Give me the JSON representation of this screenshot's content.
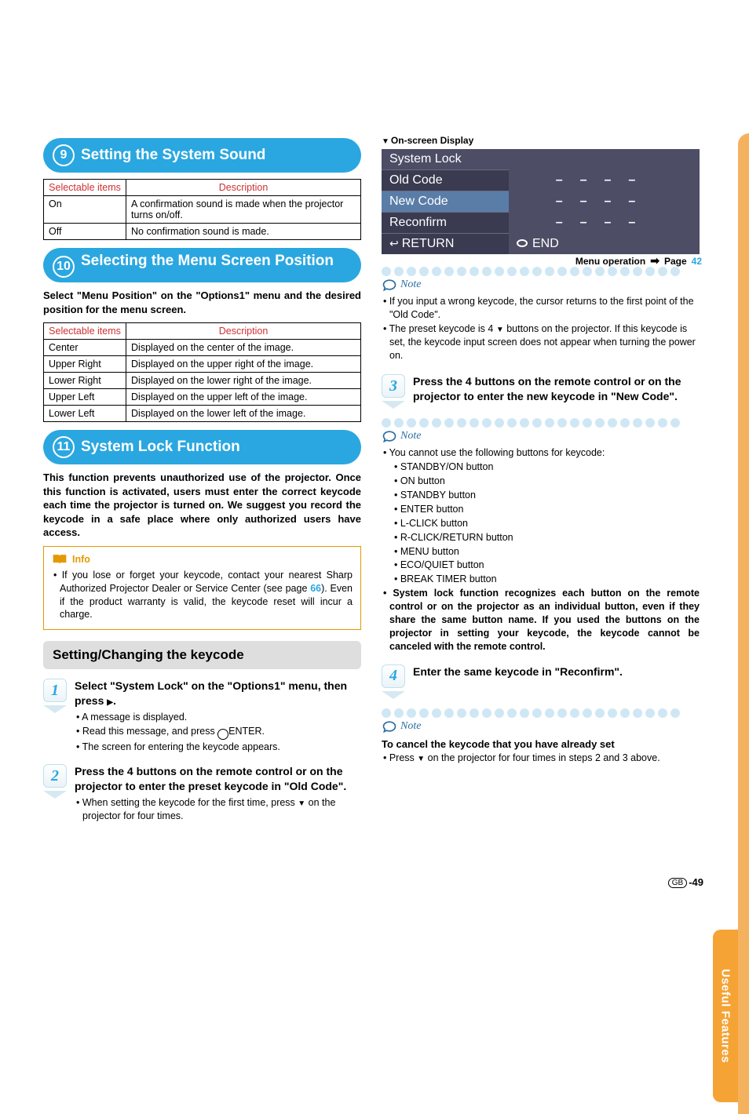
{
  "menuop": {
    "label": "Menu operation",
    "page_word": "Page",
    "page_num": "42"
  },
  "left": {
    "sec9": {
      "num": "9",
      "title": "Setting the System Sound",
      "table_headers": [
        "Selectable items",
        "Description"
      ],
      "rows": [
        {
          "item": "On",
          "desc": "A confirmation sound is made when the projector turns on/off."
        },
        {
          "item": "Off",
          "desc": "No confirmation sound is made."
        }
      ]
    },
    "sec10": {
      "num": "10",
      "title": "Selecting the Menu Screen Position",
      "para": "Select \"Menu Position\" on the \"Options1\" menu and the desired position for the menu screen.",
      "table_headers": [
        "Selectable items",
        "Description"
      ],
      "rows": [
        {
          "item": "Center",
          "desc": "Displayed on the center of the image."
        },
        {
          "item": "Upper Right",
          "desc": "Displayed on the upper right of the image."
        },
        {
          "item": "Lower Right",
          "desc": "Displayed on the lower right of the image."
        },
        {
          "item": "Upper Left",
          "desc": "Displayed on the upper left of the image."
        },
        {
          "item": "Lower Left",
          "desc": "Displayed on the lower left of the image."
        }
      ]
    },
    "sec11": {
      "num": "11",
      "title": "System Lock Function",
      "para": "This function prevents unauthorized use of the projector. Once this function is activated, users must enter the correct keycode each time the projector is turned on. We suggest you record the keycode in a safe place where only authorized users have access.",
      "info_label": "Info",
      "info_text_a": "• If you lose or forget your keycode, contact your nearest Sharp Authorized Projector Dealer or Service Center (see page ",
      "info_link": "66",
      "info_text_b": "). Even if the product warranty is valid, the keycode reset will incur a charge.",
      "greybar": "Setting/Changing the keycode",
      "step1": {
        "num": "1",
        "title_a": "Select \"System Lock\" on the \"Options1\" menu, then press ",
        "title_b": ".",
        "bul1": "• A message is displayed.",
        "bul2a": "• Read this message, and press ",
        "bul2b": "ENTER.",
        "bul3": "• The screen for entering the keycode appears."
      },
      "step2": {
        "num": "2",
        "title": "Press the 4 buttons on the remote control or on the projector to enter the preset keycode in \"Old Code\".",
        "bul_a": "• When setting the keycode for the first time, press ",
        "bul_b": " on the projector for four times."
      }
    }
  },
  "right": {
    "osd_label": "On-screen Display",
    "osd": {
      "title": "System Lock",
      "r1": "Old Code",
      "r1v": "––––",
      "r2": "New Code",
      "r2v": "––––",
      "r3": "Reconfirm",
      "r3v": "––––",
      "ret": "RETURN",
      "end": "END"
    },
    "note1_label": "Note",
    "note1": {
      "li1": "• If you input a wrong keycode, the cursor returns to the first point of the \"Old Code\".",
      "li2a": "• The preset keycode is 4 ",
      "li2b": " buttons on the projector. If this keycode is set, the keycode input screen does not appear when turning the power on."
    },
    "step3": {
      "num": "3",
      "title": "Press the 4 buttons on the remote control or on the projector to enter the new keycode in \"New Code\"."
    },
    "note2_label": "Note",
    "note2": {
      "li1": "• You cannot use the following buttons for keycode:",
      "sub": [
        "• STANDBY/ON button",
        "• ON button",
        "• STANDBY button",
        "• ENTER button",
        "• L-CLICK button",
        "• R-CLICK/RETURN button",
        "• MENU button",
        "• ECO/QUIET button",
        "• BREAK TIMER button"
      ],
      "li2": "• System lock function recognizes each button on the remote control or on the projector as an individual button, even if they share the same button name. If you used the buttons on the projector in setting your keycode, the keycode cannot be canceled with the remote control."
    },
    "step4": {
      "num": "4",
      "title": "Enter the same keycode in \"Reconfirm\"."
    },
    "note3_label": "Note",
    "cancel_hd": "To cancel the keycode that you have already set",
    "cancel_li_a": "• Press ",
    "cancel_li_b": " on the projector for four times in steps 2 and 3 above."
  },
  "sidebar": "Useful Features",
  "page_gb": "GB",
  "page_num": "-49"
}
